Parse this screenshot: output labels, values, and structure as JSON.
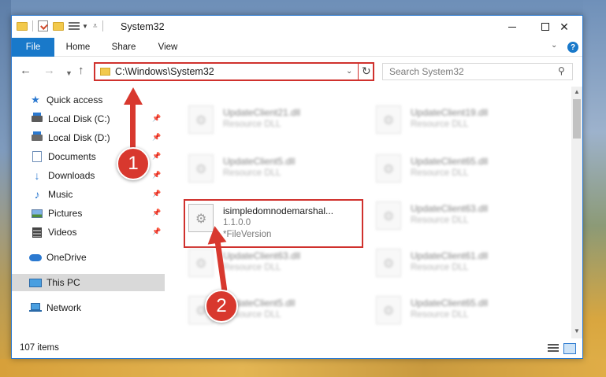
{
  "window": {
    "title": "System32",
    "controls": {
      "minimize": "—",
      "maximize": "☐",
      "close": "✕"
    }
  },
  "ribbon": {
    "tabs": [
      "File",
      "Home",
      "Share",
      "View"
    ],
    "help": "?"
  },
  "address": {
    "path": "C:\\Windows\\System32"
  },
  "search": {
    "placeholder": "Search System32"
  },
  "sidebar": {
    "quick_access": "Quick access",
    "items": [
      {
        "label": "Local Disk (C:)",
        "pinned": true
      },
      {
        "label": "Local Disk (D:)",
        "pinned": true
      },
      {
        "label": "Documents",
        "pinned": true
      },
      {
        "label": "Downloads",
        "pinned": true
      },
      {
        "label": "Music",
        "pinned": true
      },
      {
        "label": "Pictures",
        "pinned": true
      },
      {
        "label": "Videos",
        "pinned": true
      }
    ],
    "onedrive": "OneDrive",
    "this_pc": "This PC",
    "network": "Network"
  },
  "files": {
    "tiles": [
      {
        "name": "UpdateClient21.dll",
        "type": "Resource DLL"
      },
      {
        "name": "UpdateClient19.dll",
        "type": "Resource DLL"
      },
      {
        "name": "UpdateClient5.dll",
        "type": "Resource DLL"
      },
      {
        "name": "UpdateClient65.dll",
        "type": "Resource DLL"
      },
      {
        "name": "UpdateClient63.dll",
        "type": "Resource DLL"
      },
      {
        "name": "UpdateClient63.dll",
        "type": "Resource DLL"
      },
      {
        "name": "UpdateClient61.dll",
        "type": "Resource DLL"
      },
      {
        "name": "UpdateClient5.dll",
        "type": "Resource DLL"
      },
      {
        "name": "UpdateClient65.dll",
        "type": "Resource DLL"
      }
    ],
    "highlighted": {
      "name": "isimpledomnodemarshal...",
      "version": "1.1.0.0",
      "description": "*FileVersion"
    }
  },
  "status": {
    "item_count": "107 items"
  },
  "annotations": {
    "step1": "1",
    "step2": "2"
  },
  "colors": {
    "accent": "#1979ca",
    "highlight": "#d0312d",
    "callout": "#d8382e"
  }
}
